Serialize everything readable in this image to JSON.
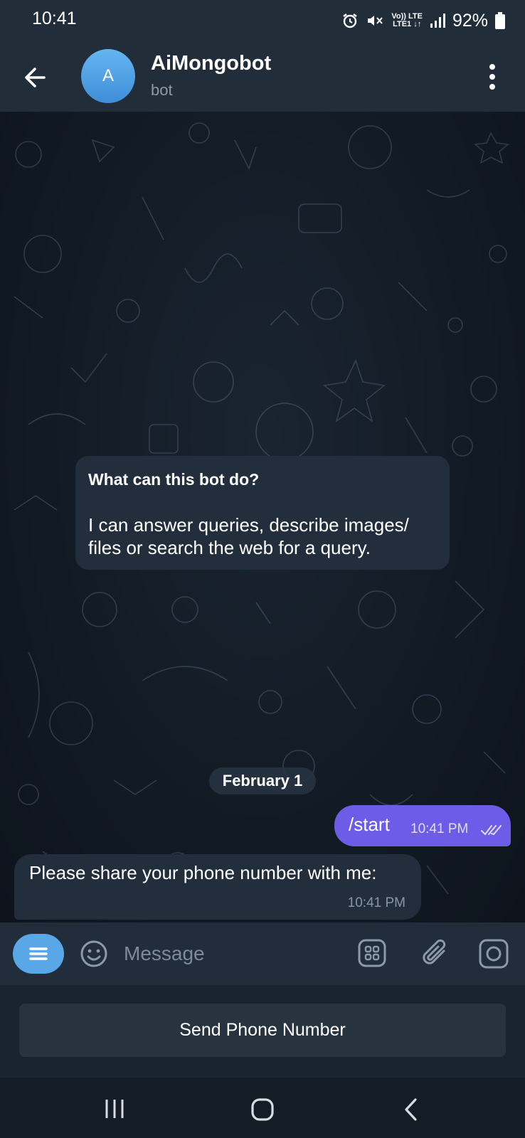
{
  "status_bar": {
    "time": "10:41",
    "network_top": "Vo)) LTE",
    "network_bottom": "LTE1 ↓↑",
    "battery": "92%"
  },
  "header": {
    "avatar_letter": "A",
    "title": "AiMongobot",
    "subtitle": "bot"
  },
  "chat": {
    "intro": {
      "title": "What can this bot do?",
      "body": "I can answer queries, describe images/ files or search the web for a query."
    },
    "date_separator": "February 1",
    "messages": [
      {
        "direction": "outgoing",
        "text": "/start",
        "time": "10:41 PM",
        "status": "read"
      },
      {
        "direction": "incoming",
        "text": "Please share your phone number with me:",
        "time": "10:41 PM"
      }
    ]
  },
  "input_bar": {
    "placeholder": "Message"
  },
  "keyboard": {
    "button_label": "Send Phone Number"
  },
  "icons": {
    "back": "arrow-left-icon",
    "more": "more-vertical-icon",
    "menu": "menu-icon",
    "emoji": "emoji-icon",
    "commands": "bot-commands-icon",
    "attach": "paperclip-icon",
    "camera": "camera-icon"
  },
  "colors": {
    "accent": "#5aa7e8",
    "outgoing_bubble": "#6c5ce7",
    "incoming_bubble": "#222e3c",
    "header_bg": "#222d3a"
  }
}
